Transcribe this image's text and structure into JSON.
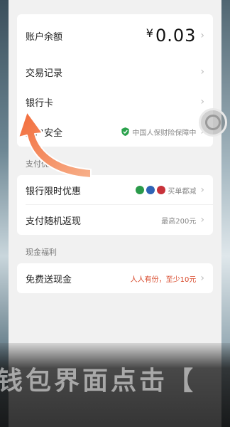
{
  "account": {
    "balance_label": "账户余额",
    "balance_currency": "¥",
    "balance_value": "0.03",
    "transactions_label": "交易记录",
    "bank_card_label": "银行卡",
    "security_label": "账户安全",
    "insurance_text": "中国人保财险保障中"
  },
  "payment": {
    "section_title": "支付优惠",
    "bank_offer_label": "银行限时优惠",
    "bank_offer_hint": "买单都减",
    "random_cashback_label": "支付随机返现",
    "random_cashback_hint": "最高200元"
  },
  "cash": {
    "section_title": "现金福利",
    "free_cash_label": "免费送现金",
    "free_cash_hint": "人人有份，至少10元"
  },
  "chevron": "›",
  "overlay_caption": "钱包界面点击【",
  "colors": {
    "accent_red": "#d84a2c",
    "shield_green": "#2ba24c",
    "arrow_orange": "#f08a4b"
  }
}
